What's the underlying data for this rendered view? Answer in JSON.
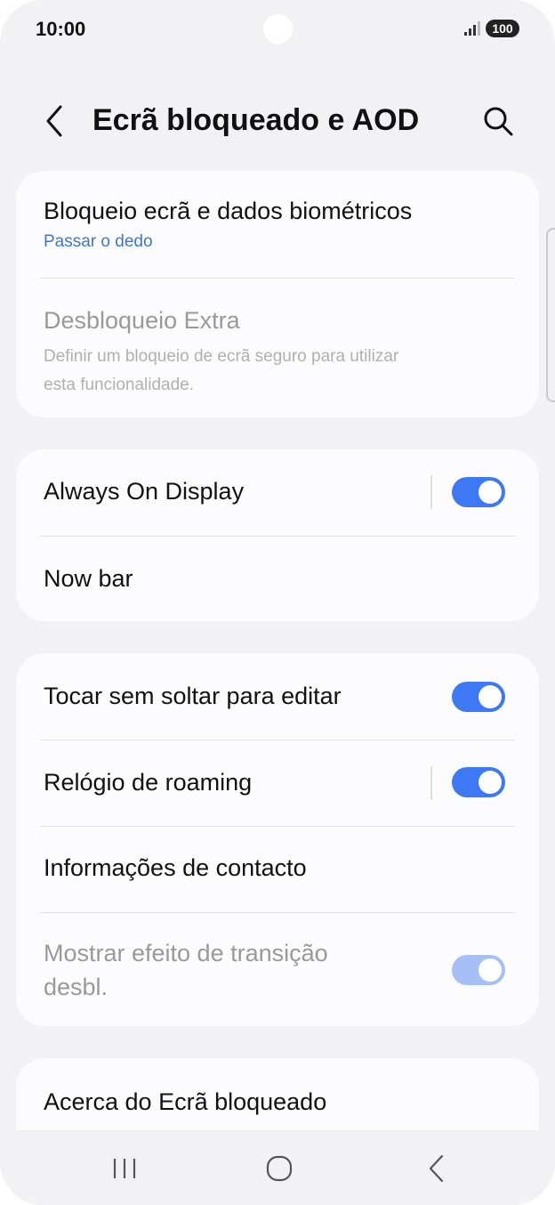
{
  "status_bar": {
    "time": "10:00",
    "battery": "100"
  },
  "header": {
    "title": "Ecrã bloqueado e AOD"
  },
  "card1": {
    "lock_screen": {
      "title": "Bloqueio ecrã e dados biométricos",
      "subtitle": "Passar o dedo"
    },
    "extra_unlock": {
      "title": "Desbloqueio Extra",
      "subtitle_line1": "Definir um bloqueio de ecrã seguro para utilizar",
      "subtitle_line2": "esta funcionalidade."
    }
  },
  "card2": {
    "always_on_display": {
      "title": "Always On Display",
      "toggle": "on"
    },
    "now_bar": {
      "title": "Now bar"
    }
  },
  "card3": {
    "touch_hold_edit": {
      "title": "Tocar sem soltar para editar",
      "toggle": "on"
    },
    "roaming_clock": {
      "title": "Relógio de roaming",
      "toggle": "on"
    },
    "contact_info": {
      "title": "Informações de contacto"
    },
    "unlock_transition": {
      "title_line1": "Mostrar efeito de transição",
      "title_line2": "desbl.",
      "toggle": "on (disabled)"
    }
  },
  "card4": {
    "about": {
      "title": "Acerca do Ecrã bloqueado"
    }
  },
  "colors": {
    "accent": "#3e79f5",
    "link": "#3c76d7",
    "background": "#f2f2f4",
    "card": "#fcfcfe"
  },
  "icons": {
    "back": "chevron-left-icon",
    "search": "search-icon",
    "recents": "recents-icon",
    "home": "home-icon",
    "nav_back": "nav-back-icon"
  }
}
